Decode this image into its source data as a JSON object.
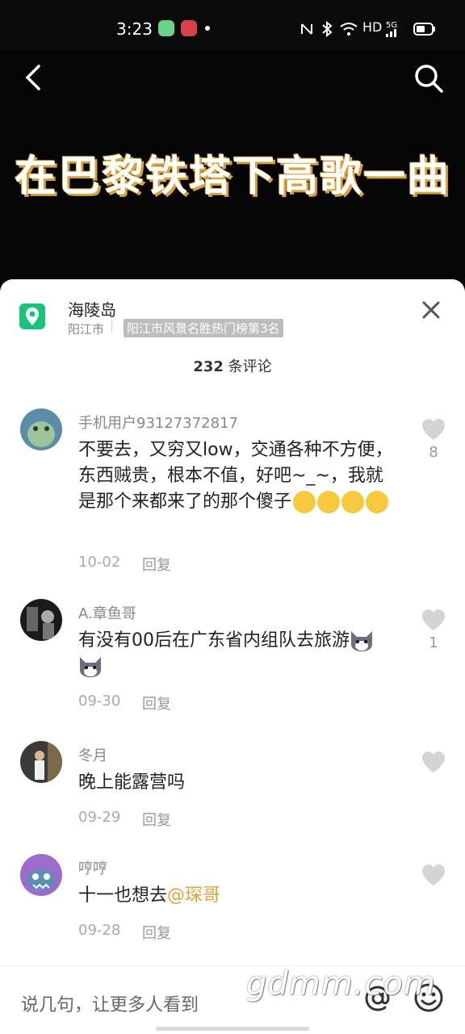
{
  "status_bar": {
    "time": "3:23",
    "network_hd": "HD",
    "network_5g": "5G"
  },
  "video": {
    "title": "在巴黎铁塔下高歌一曲"
  },
  "location": {
    "name": "海陵岛",
    "city": "阳江市",
    "rank": "阳江市风景名胜热门榜第3名"
  },
  "comments_header": {
    "count": "232",
    "label": " 条评论"
  },
  "comments": [
    {
      "user": "手机用户93127372817",
      "text": "不要去，又穷又low，交通各种不方便，东西贼贵，根本不值，好吧~_~，我就是那个来都来了的那个傻子",
      "date": "10-02",
      "reply": "回复",
      "likes": "8"
    },
    {
      "user": "A.章鱼哥",
      "text": "有没有00后在广东省内组队去旅游",
      "date": "09-30",
      "reply": "回复",
      "likes": "1"
    },
    {
      "user": "冬月",
      "text": "晚上能露营吗",
      "date": "09-29",
      "reply": "回复",
      "likes": ""
    },
    {
      "user": "哼哼",
      "text": "十一也想去",
      "mention": "@琛哥",
      "date": "09-28",
      "reply": "回复",
      "likes": ""
    }
  ],
  "input": {
    "placeholder": "说几句，让更多人看到"
  },
  "watermark": "gdmm.com"
}
